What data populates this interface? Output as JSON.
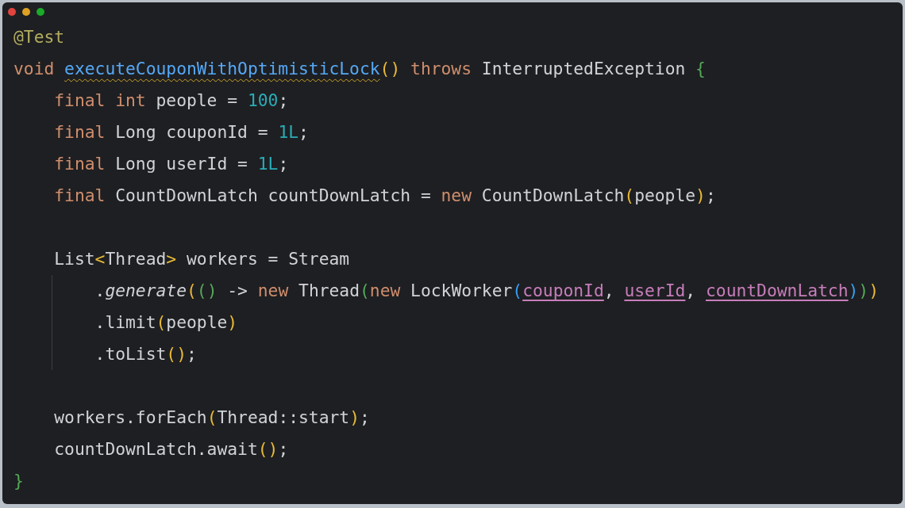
{
  "window": {
    "controls": [
      {
        "kind": "close"
      },
      {
        "kind": "minimize"
      },
      {
        "kind": "zoom"
      }
    ]
  },
  "code_blocks": [
    {
      "lines": [
        {
          "tokens": [
            {
              "text": "@Test",
              "kind": "ann"
            }
          ]
        },
        {
          "tokens": [
            {
              "text": "void ",
              "kind": "kw"
            },
            {
              "text": "executeCouponWithOptimisticLock",
              "kind": "fn_warn"
            },
            {
              "text": "()",
              "kind": "p1"
            },
            {
              "text": " throws",
              "kind": "kw"
            },
            {
              "text": " InterruptedException ",
              "kind": "txt"
            },
            {
              "text": "{",
              "kind": "p2"
            }
          ]
        },
        {
          "tokens": [
            {
              "text": "    final int",
              "kind": "kw"
            },
            {
              "text": " people = ",
              "kind": "txt"
            },
            {
              "text": "100",
              "kind": "num"
            },
            {
              "text": ";",
              "kind": "txt"
            }
          ]
        },
        {
          "tokens": [
            {
              "text": "    final",
              "kind": "kw"
            },
            {
              "text": " Long couponId = ",
              "kind": "txt"
            },
            {
              "text": "1L",
              "kind": "num"
            },
            {
              "text": ";",
              "kind": "txt"
            }
          ]
        },
        {
          "tokens": [
            {
              "text": "    final",
              "kind": "kw"
            },
            {
              "text": " Long userId = ",
              "kind": "txt"
            },
            {
              "text": "1L",
              "kind": "num"
            },
            {
              "text": ";",
              "kind": "txt"
            }
          ]
        },
        {
          "tokens": [
            {
              "text": "    final",
              "kind": "kw"
            },
            {
              "text": " CountDownLatch countDownLatch = ",
              "kind": "txt"
            },
            {
              "text": "new",
              "kind": "kw"
            },
            {
              "text": " CountDownLatch",
              "kind": "txt"
            },
            {
              "text": "(",
              "kind": "p1"
            },
            {
              "text": "people",
              "kind": "txt"
            },
            {
              "text": ")",
              "kind": "p1"
            },
            {
              "text": ";",
              "kind": "txt"
            }
          ]
        }
      ]
    },
    {
      "lines": [
        {
          "tokens": [
            {
              "text": "    List",
              "kind": "txt"
            },
            {
              "text": "<",
              "kind": "p1"
            },
            {
              "text": "Thread",
              "kind": "txt"
            },
            {
              "text": ">",
              "kind": "p1"
            },
            {
              "text": " workers = Stream",
              "kind": "txt"
            }
          ]
        },
        {
          "indent_guide": true,
          "tokens": [
            {
              "text": "        .",
              "kind": "txt"
            },
            {
              "text": "generate",
              "kind": "fn_italic"
            },
            {
              "text": "(",
              "kind": "p1"
            },
            {
              "text": "()",
              "kind": "p2"
            },
            {
              "text": " -> ",
              "kind": "txt"
            },
            {
              "text": "new",
              "kind": "kw"
            },
            {
              "text": " Thread",
              "kind": "txt"
            },
            {
              "text": "(",
              "kind": "p2"
            },
            {
              "text": "new",
              "kind": "kw"
            },
            {
              "text": " LockWorker",
              "kind": "txt"
            },
            {
              "text": "(",
              "kind": "p3"
            },
            {
              "text": "couponId",
              "kind": "param"
            },
            {
              "text": ", ",
              "kind": "txt"
            },
            {
              "text": "userId",
              "kind": "param"
            },
            {
              "text": ", ",
              "kind": "txt"
            },
            {
              "text": "countDownLatch",
              "kind": "param"
            },
            {
              "text": ")",
              "kind": "p3"
            },
            {
              "text": ")",
              "kind": "p2"
            },
            {
              "text": ")",
              "kind": "p1"
            }
          ]
        },
        {
          "indent_guide": true,
          "tokens": [
            {
              "text": "        .limit",
              "kind": "txt"
            },
            {
              "text": "(",
              "kind": "p1"
            },
            {
              "text": "people",
              "kind": "txt"
            },
            {
              "text": ")",
              "kind": "p1"
            }
          ]
        },
        {
          "indent_guide": true,
          "tokens": [
            {
              "text": "        .toList",
              "kind": "txt"
            },
            {
              "text": "()",
              "kind": "p1"
            },
            {
              "text": ";",
              "kind": "txt"
            }
          ]
        }
      ]
    },
    {
      "lines": [
        {
          "tokens": [
            {
              "text": "    workers.forEach",
              "kind": "txt"
            },
            {
              "text": "(",
              "kind": "p1"
            },
            {
              "text": "Thread::start",
              "kind": "txt"
            },
            {
              "text": ")",
              "kind": "p1"
            },
            {
              "text": ";",
              "kind": "txt"
            }
          ]
        },
        {
          "tokens": [
            {
              "text": "    countDownLatch.await",
              "kind": "txt"
            },
            {
              "text": "()",
              "kind": "p1"
            },
            {
              "text": ";",
              "kind": "txt"
            }
          ]
        },
        {
          "tokens": [
            {
              "text": "}",
              "kind": "p2"
            }
          ]
        }
      ]
    }
  ]
}
